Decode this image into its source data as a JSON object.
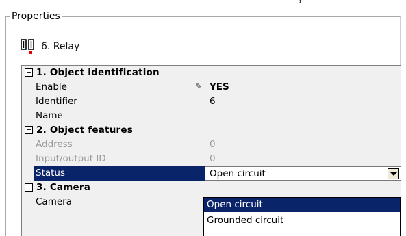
{
  "window": {
    "top_strip_text": "y"
  },
  "group": {
    "legend": "Properties"
  },
  "header": {
    "title": "6. Relay",
    "icon": "relay-icon"
  },
  "grid": {
    "categories": [
      {
        "toggle": "⊟",
        "label": "1. Object identification"
      },
      {
        "toggle": "⊟",
        "label": "2. Object features"
      },
      {
        "toggle": "⊟",
        "label": "3. Camera"
      }
    ],
    "rows": {
      "enable": {
        "name": "Enable",
        "value": "YES"
      },
      "identifier": {
        "name": "Identifier",
        "value": "6"
      },
      "name": {
        "name": "Name",
        "value": ""
      },
      "address": {
        "name": "Address",
        "value": "0"
      },
      "io_id": {
        "name": "Input/output ID",
        "value": "0"
      },
      "status": {
        "name": "Status",
        "value": "Open circuit"
      },
      "camera": {
        "name": "Camera",
        "value": ""
      }
    }
  },
  "dropdown": {
    "options": [
      "Open circuit",
      "Grounded circuit"
    ],
    "selected_index": 0
  },
  "colors": {
    "selection": "#0a246a",
    "grid_bg": "#f0f0f0",
    "disabled_text": "#9a9a9a",
    "relay_icon_dot": "#e00000"
  }
}
